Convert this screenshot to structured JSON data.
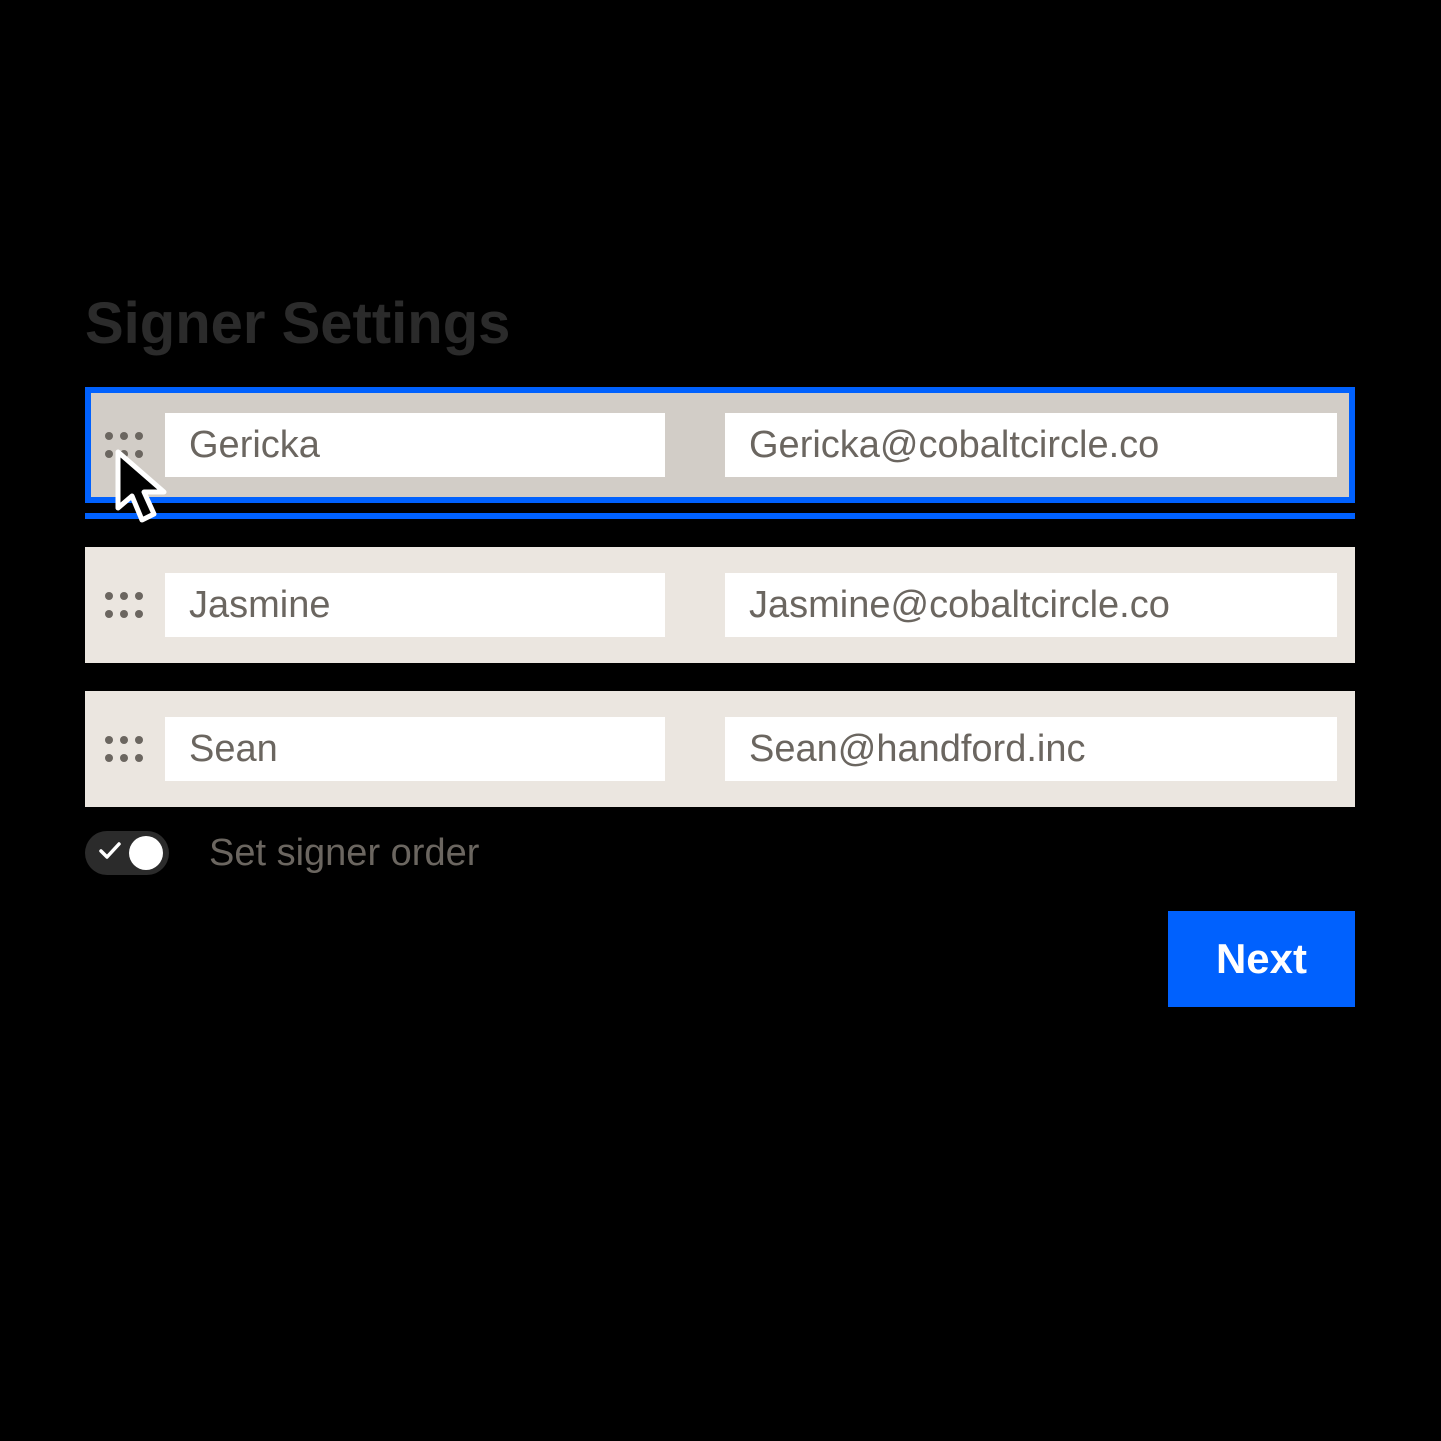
{
  "header": {
    "title": "Signer Settings"
  },
  "signers": [
    {
      "name": "Gericka",
      "email": "Gericka@cobaltcircle.co",
      "selected": true
    },
    {
      "name": "Jasmine",
      "email": "Jasmine@cobaltcircle.co",
      "selected": false
    },
    {
      "name": "Sean",
      "email": "Sean@handford.inc",
      "selected": false
    }
  ],
  "toggle": {
    "label": "Set signer order",
    "on": true
  },
  "actions": {
    "next_label": "Next"
  },
  "colors": {
    "accent": "#0061fe",
    "row_bg": "#ebe6e0",
    "row_selected_bg": "#d2cdc7",
    "text_muted": "#6b6660"
  }
}
